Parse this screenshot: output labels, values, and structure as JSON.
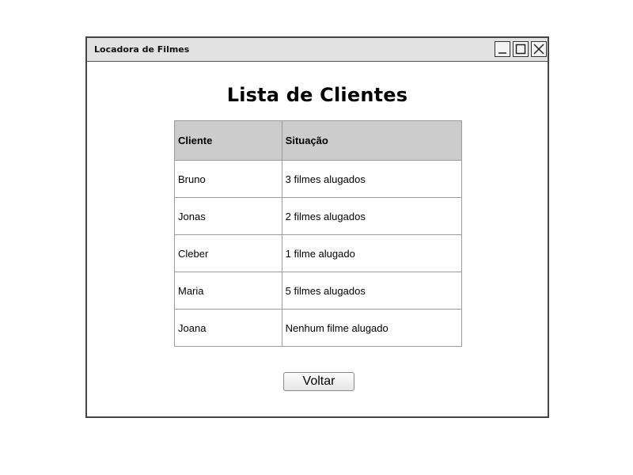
{
  "window": {
    "title": "Locadora de Filmes",
    "controls": {
      "minimize_icon": "minimize-icon",
      "maximize_icon": "maximize-icon",
      "close_icon": "close-icon"
    }
  },
  "page": {
    "title": "Lista de Clientes"
  },
  "table": {
    "headers": [
      "Cliente",
      "Situação"
    ],
    "rows": [
      [
        "Bruno",
        "3 filmes alugados"
      ],
      [
        "Jonas",
        "2 filmes alugados"
      ],
      [
        "Cleber",
        "1 filme alugado"
      ],
      [
        "Maria",
        "5 filmes alugados"
      ],
      [
        "Joana",
        "Nenhum filme alugado"
      ]
    ]
  },
  "actions": {
    "back_label": "Voltar"
  },
  "colors": {
    "titlebar_bg": "#e2e2e2",
    "header_bg": "#cccccc",
    "border": "#9a9a9a"
  }
}
